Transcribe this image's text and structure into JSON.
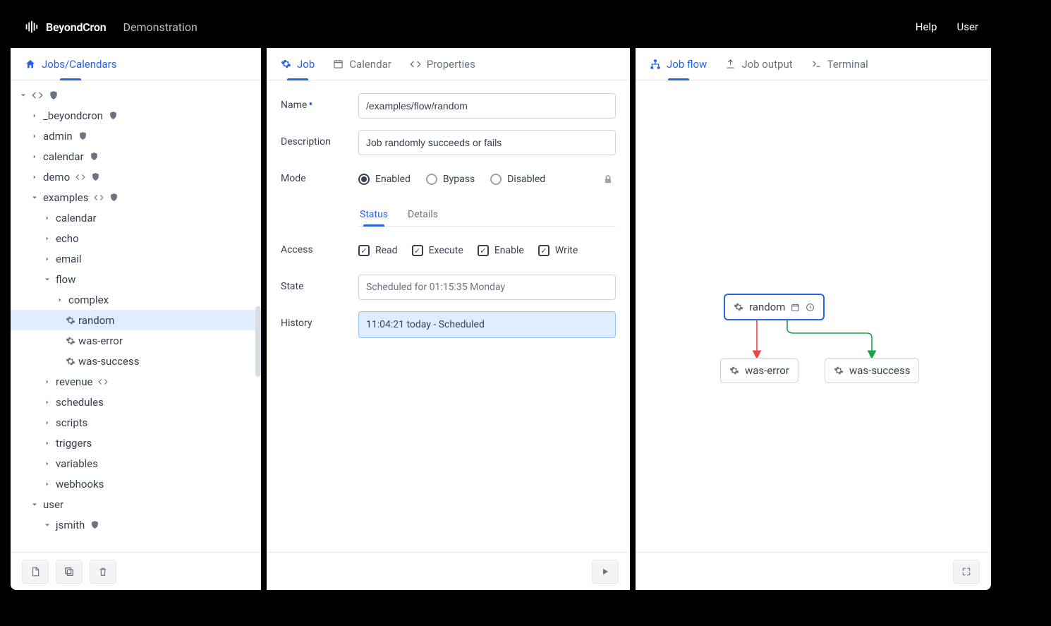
{
  "topbar": {
    "brand": "BeyondCron",
    "subtitle": "Demonstration",
    "help": "Help",
    "user": "User"
  },
  "left": {
    "title": "Jobs/Calendars",
    "tree": {
      "root_items": [
        {
          "label": "_beyondcron",
          "shield": true
        },
        {
          "label": "admin",
          "shield": true
        },
        {
          "label": "calendar",
          "shield": true
        },
        {
          "label": "demo",
          "code": true,
          "shield": true
        }
      ],
      "examples": {
        "label": "examples",
        "children": [
          {
            "label": "calendar"
          },
          {
            "label": "echo"
          },
          {
            "label": "email"
          }
        ],
        "flow": {
          "label": "flow",
          "children": [
            {
              "label": "complex",
              "chev": true
            },
            {
              "label": "random",
              "gear": true,
              "selected": true
            },
            {
              "label": "was-error",
              "gear": true
            },
            {
              "label": "was-success",
              "gear": true
            }
          ]
        },
        "after": [
          {
            "label": "revenue",
            "code": true
          },
          {
            "label": "schedules"
          },
          {
            "label": "scripts"
          },
          {
            "label": "triggers"
          },
          {
            "label": "variables"
          },
          {
            "label": "webhooks"
          }
        ]
      },
      "user": {
        "label": "user",
        "children": [
          {
            "label": "jsmith",
            "shield": true
          }
        ]
      }
    }
  },
  "middle": {
    "tabs": {
      "job": "Job",
      "calendar": "Calendar",
      "properties": "Properties"
    },
    "form": {
      "name_label": "Name",
      "name_value": "/examples/flow/random",
      "desc_label": "Description",
      "desc_value": "Job randomly succeeds or fails",
      "mode_label": "Mode",
      "mode_options": {
        "enabled": "Enabled",
        "bypass": "Bypass",
        "disabled": "Disabled"
      },
      "subtabs": {
        "status": "Status",
        "details": "Details"
      },
      "access_label": "Access",
      "access": {
        "read": "Read",
        "execute": "Execute",
        "enable": "Enable",
        "write": "Write"
      },
      "state_label": "State",
      "state_value": "Scheduled for 01:15:35 Monday",
      "history_label": "History",
      "history_value": "11:04:21 today - Scheduled"
    }
  },
  "right": {
    "tabs": {
      "flow": "Job flow",
      "output": "Job output",
      "terminal": "Terminal"
    },
    "nodes": {
      "random": "random",
      "error": "was-error",
      "success": "was-success"
    }
  }
}
